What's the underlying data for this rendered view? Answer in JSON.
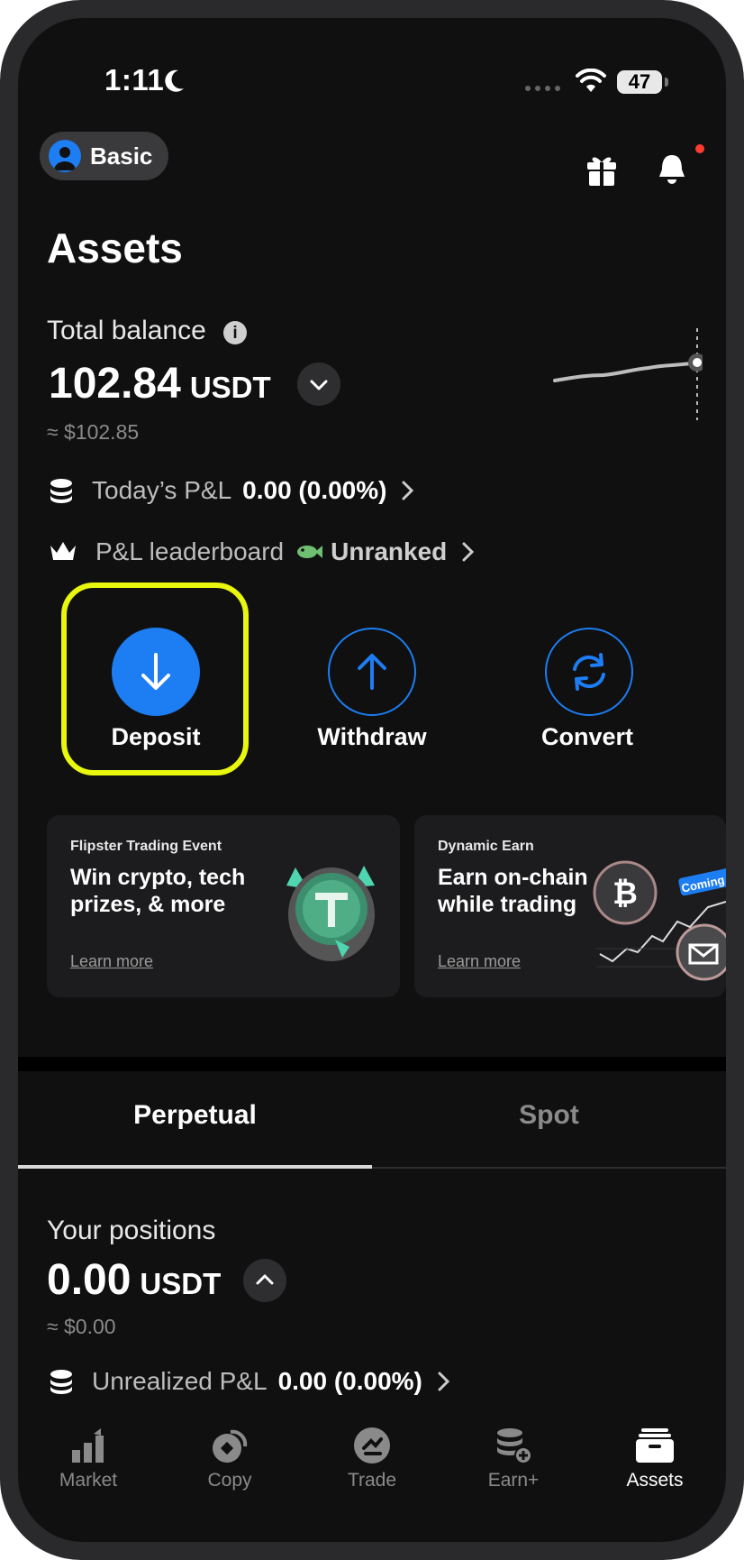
{
  "status_bar": {
    "time": "1:11",
    "battery": "47"
  },
  "header": {
    "tier_label": "Basic"
  },
  "page_title": "Assets",
  "balance": {
    "label": "Total balance",
    "amount": "102.84",
    "currency": "USDT",
    "approx": "≈ $102.85"
  },
  "todays_pnl": {
    "label": "Today’s P&L",
    "value": "0.00 (0.00%)"
  },
  "leaderboard": {
    "label": "P&L leaderboard",
    "value": "Unranked"
  },
  "actions": [
    {
      "label": "Deposit"
    },
    {
      "label": "Withdraw"
    },
    {
      "label": "Convert"
    }
  ],
  "promos": [
    {
      "tag": "Flipster Trading Event",
      "headline": "Win crypto, tech prizes, & more",
      "link": "Learn more"
    },
    {
      "tag": "Dynamic Earn",
      "headline": "Earn on-chain while trading",
      "link": "Learn more",
      "badge": "Coming"
    }
  ],
  "tabs": [
    {
      "label": "Perpetual",
      "active": true
    },
    {
      "label": "Spot",
      "active": false
    }
  ],
  "positions": {
    "label": "Your positions",
    "amount": "0.00",
    "currency": "USDT",
    "approx": "≈ $0.00",
    "unrealized_label": "Unrealized P&L",
    "unrealized_value": "0.00 (0.00%)"
  },
  "nav": [
    {
      "label": "Market",
      "icon": "market-icon"
    },
    {
      "label": "Copy",
      "icon": "copy-icon"
    },
    {
      "label": "Trade",
      "icon": "trade-icon"
    },
    {
      "label": "Earn+",
      "icon": "earn-icon"
    },
    {
      "label": "Assets",
      "icon": "assets-icon",
      "active": true
    }
  ],
  "colors": {
    "accent": "#1d7df2",
    "highlight": "#e8f70d",
    "background": "#101010"
  }
}
